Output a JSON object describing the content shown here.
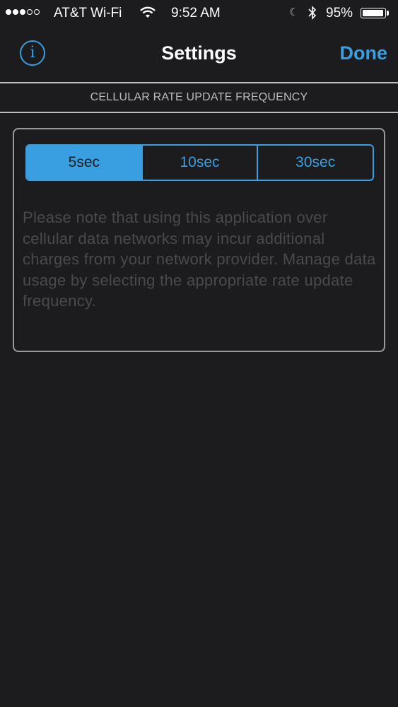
{
  "status_bar": {
    "carrier": "AT&T Wi-Fi",
    "time": "9:52 AM",
    "battery": "95%",
    "battery_level": 0.95,
    "signal_bars_filled": 3,
    "signal_bars_total": 5
  },
  "nav": {
    "title": "Settings",
    "done_label": "Done",
    "info_label": "i"
  },
  "section": {
    "header": "CELLULAR RATE UPDATE FREQUENCY"
  },
  "frequency": {
    "options": [
      "5sec",
      "10sec",
      "30sec"
    ],
    "selected": "5sec"
  },
  "note": "Please note that using this application over cellular data networks may incur additional charges from your network provider. Manage data usage by selecting the appropriate rate update frequency.",
  "colors": {
    "accent": "#3a9fe0",
    "background": "#1c1c1e",
    "note_text": "#4a4a4c"
  }
}
